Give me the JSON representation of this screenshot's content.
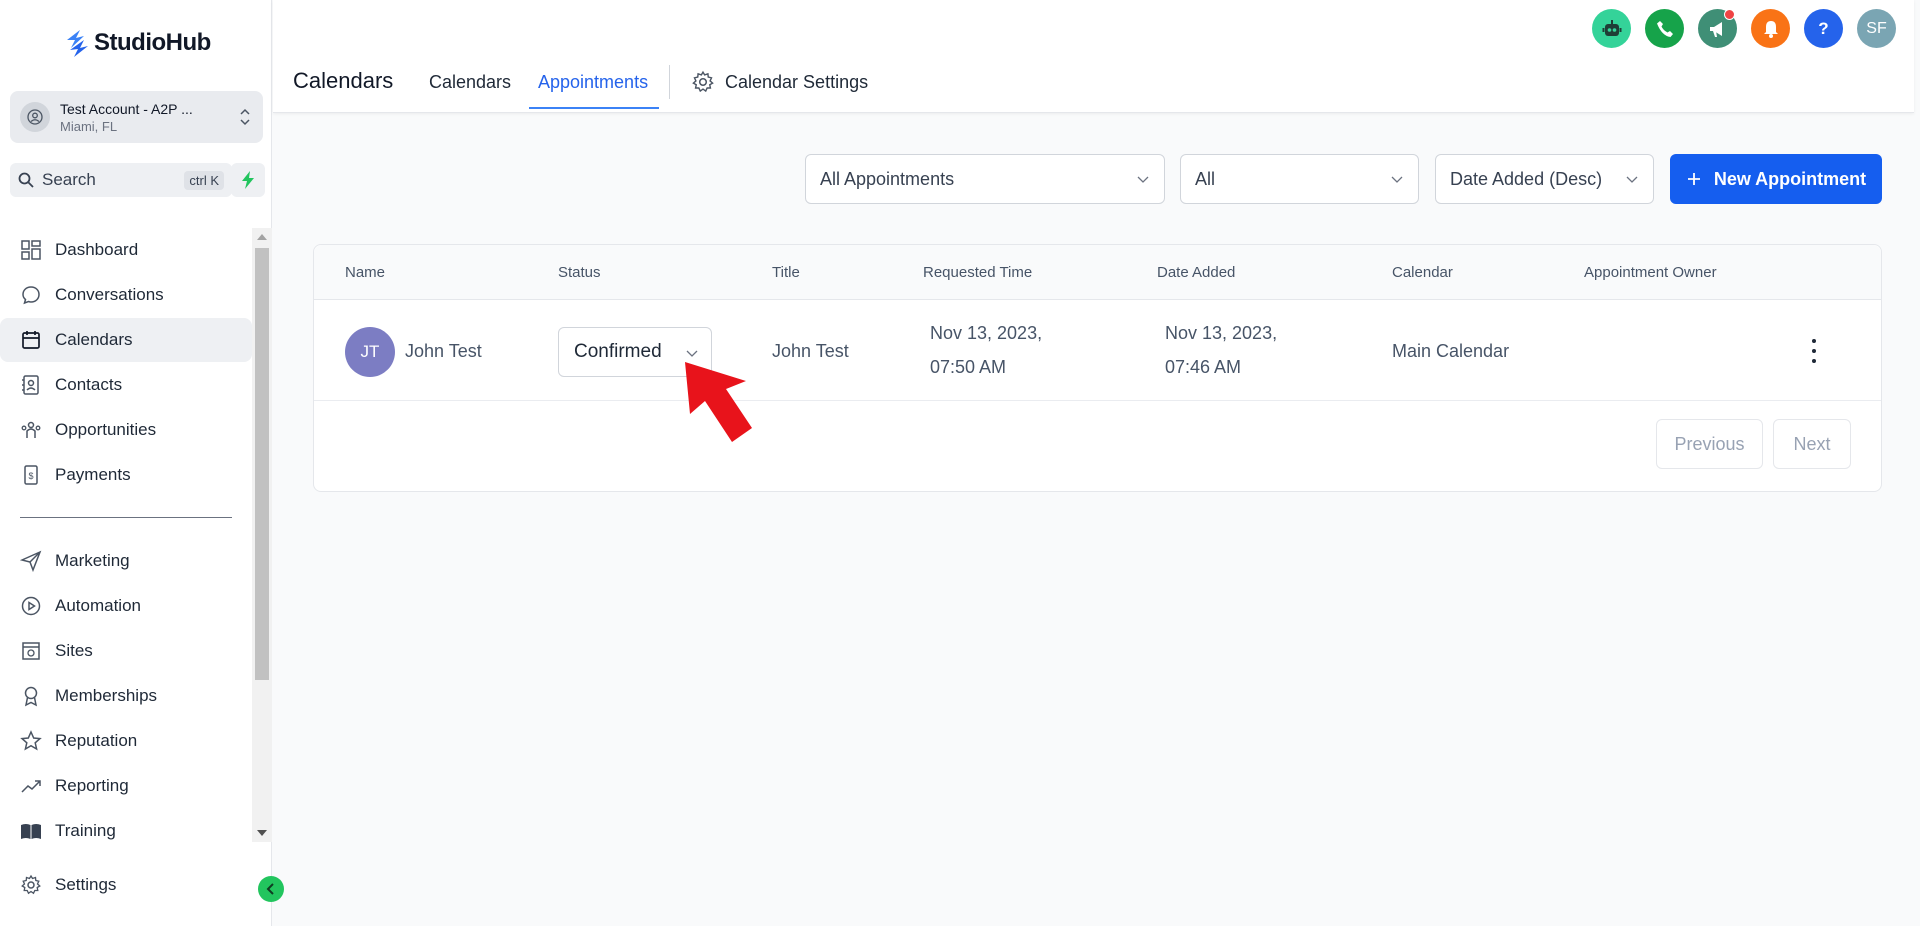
{
  "brand": {
    "name": "StudioHub"
  },
  "account": {
    "name": "Test Account - A2P ...",
    "location": "Miami, FL"
  },
  "search": {
    "label": "Search",
    "shortcut": "ctrl K"
  },
  "sidebar": {
    "items": [
      {
        "label": "Dashboard",
        "icon": "dashboard-icon"
      },
      {
        "label": "Conversations",
        "icon": "chat-icon"
      },
      {
        "label": "Calendars",
        "icon": "calendar-icon",
        "active": true
      },
      {
        "label": "Contacts",
        "icon": "contacts-icon"
      },
      {
        "label": "Opportunities",
        "icon": "opportunities-icon"
      },
      {
        "label": "Payments",
        "icon": "payments-icon"
      },
      {
        "label": "Marketing",
        "icon": "send-icon"
      },
      {
        "label": "Automation",
        "icon": "automation-icon"
      },
      {
        "label": "Sites",
        "icon": "sites-icon"
      },
      {
        "label": "Memberships",
        "icon": "award-icon"
      },
      {
        "label": "Reputation",
        "icon": "star-icon"
      },
      {
        "label": "Reporting",
        "icon": "trend-icon"
      },
      {
        "label": "Training",
        "icon": "book-icon"
      }
    ],
    "settings": "Settings"
  },
  "header": {
    "title": "Calendars",
    "tabs": [
      "Calendars",
      "Appointments"
    ],
    "active_tab": "Appointments",
    "settings_tab": "Calendar Settings",
    "user_initials": "SF",
    "help_label": "?"
  },
  "filters": {
    "appointments": "All Appointments",
    "status": "All",
    "sort": "Date Added (Desc)",
    "new_button": "New Appointment"
  },
  "table": {
    "columns": [
      "Name",
      "Status",
      "Title",
      "Requested Time",
      "Date Added",
      "Calendar",
      "Appointment Owner"
    ],
    "rows": [
      {
        "initials": "JT",
        "name": "John Test",
        "status": "Confirmed",
        "title": "John Test",
        "requested_time_line1": "Nov 13, 2023,",
        "requested_time_line2": "07:50 AM",
        "date_added_line1": "Nov 13, 2023,",
        "date_added_line2": "07:46 AM",
        "calendar": "Main Calendar",
        "owner": ""
      }
    ]
  },
  "pagination": {
    "previous": "Previous",
    "next": "Next"
  },
  "colors": {
    "primary": "#155eef",
    "active_tab": "#2563eb",
    "annotation_arrow": "#e8131b"
  }
}
